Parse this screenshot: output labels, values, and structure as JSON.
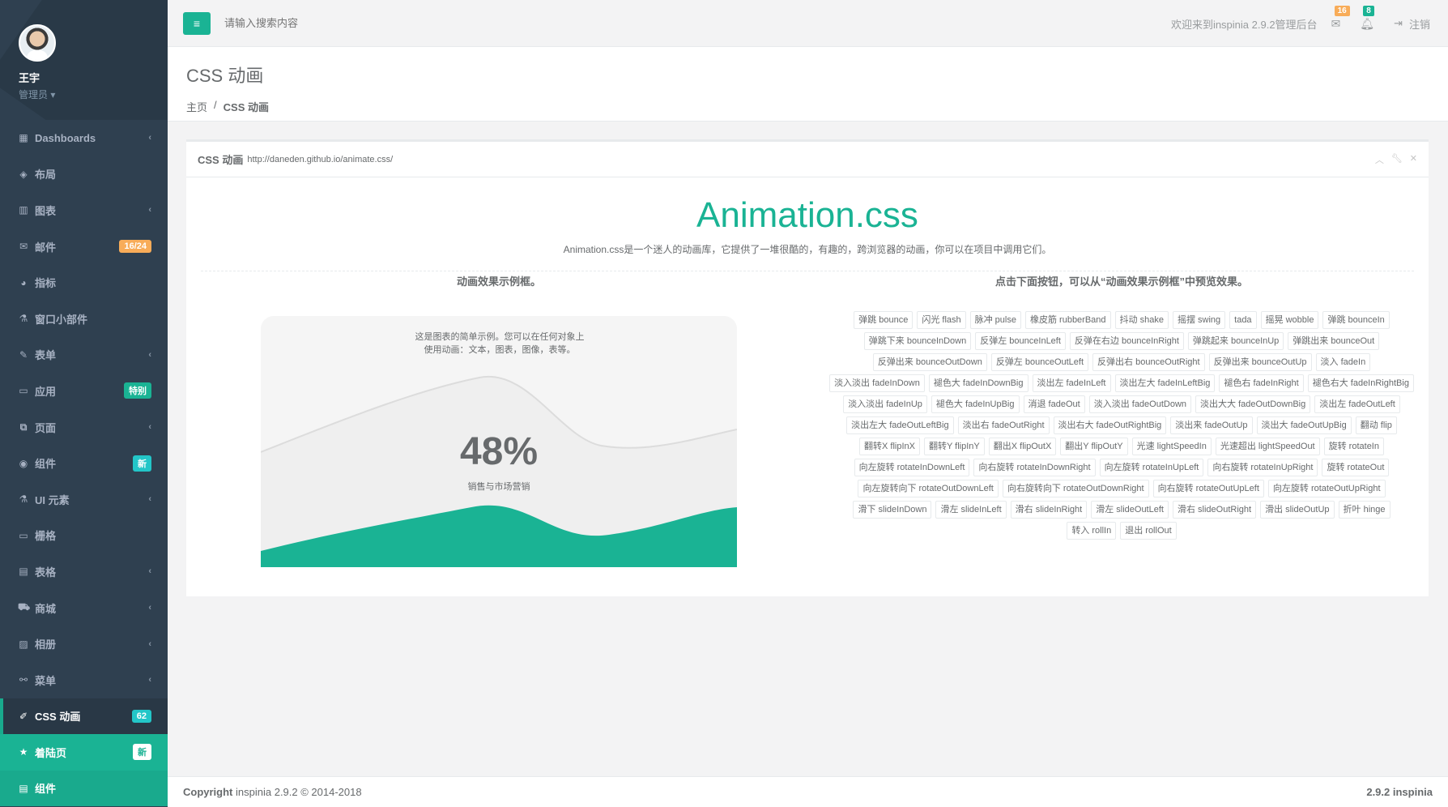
{
  "profile": {
    "name": "王宇",
    "role": "管理员 ▾"
  },
  "sidebar": {
    "items": [
      {
        "icon": "▦",
        "label": "Dashboards",
        "arrow": "‹"
      },
      {
        "icon": "◈",
        "label": "布局"
      },
      {
        "icon": "▥",
        "label": "图表",
        "arrow": "‹"
      },
      {
        "icon": "✉",
        "label": "邮件",
        "badge": "16/24"
      },
      {
        "icon": "◕",
        "label": "指标"
      },
      {
        "icon": "⚗",
        "label": "窗口小部件"
      },
      {
        "icon": "✎",
        "label": "表单",
        "arrow": "‹"
      },
      {
        "icon": "▭",
        "label": "应用",
        "badge": "特别"
      },
      {
        "icon": "⧉",
        "label": "页面",
        "arrow": "‹"
      },
      {
        "icon": "◉",
        "label": "组件",
        "badge": "新"
      },
      {
        "icon": "⚗",
        "label": "UI 元素",
        "arrow": "‹"
      },
      {
        "icon": "▭",
        "label": "栅格"
      },
      {
        "icon": "▤",
        "label": "表格",
        "arrow": "‹"
      },
      {
        "icon": "⛟",
        "label": "商城",
        "arrow": "‹"
      },
      {
        "icon": "▨",
        "label": "相册",
        "arrow": "‹"
      },
      {
        "icon": "⚯",
        "label": "菜单",
        "arrow": "‹"
      },
      {
        "icon": "✐",
        "label": "CSS 动画",
        "badge": "62"
      },
      {
        "icon": "★",
        "label": "着陆页",
        "badge": "新"
      },
      {
        "icon": "▤",
        "label": "组件"
      }
    ]
  },
  "topbar": {
    "toggle": "≡",
    "search_placeholder": "请输入搜索内容",
    "welcome": "欢迎来到inspinia 2.9.2管理后台",
    "mail_count": "16",
    "bell_count": "8",
    "logout": "注销"
  },
  "heading": {
    "title": "CSS 动画",
    "crumb_home": "主页",
    "crumb_sep": "/",
    "crumb_current": "CSS 动画"
  },
  "panel": {
    "title": "CSS 动画",
    "url": "http://daneden.github.io/animate.css/",
    "hero_title": "Animation.css",
    "hero_desc": "Animation.css是一个迷人的动画库，它提供了一堆很酷的，有趣的，跨浏览器的动画，你可以在项目中调用它们。",
    "left_head": "动画效果示例框。",
    "right_head": "点击下面按钮，可以从“动画效果示例框”中预览效果。",
    "demo_text": "这是图表的简单示例。您可以在任何对象上使用动画：文本，图表，图像，表等。",
    "demo_value": "48%",
    "demo_label": "销售与市场营销",
    "buttons": [
      "弹跳 bounce",
      "闪光 flash",
      "脉冲 pulse",
      "橡皮筋 rubberBand",
      "抖动 shake",
      "摇摆 swing",
      "tada",
      "摇晃 wobble",
      "弹跳 bounceIn",
      "弹跳下来 bounceInDown",
      "反弹左 bounceInLeft",
      "反弹在右边 bounceInRight",
      "弹跳起来 bounceInUp",
      "弹跳出来 bounceOut",
      "反弹出来 bounceOutDown",
      "反弹左 bounceOutLeft",
      "反弹出右 bounceOutRight",
      "反弹出来 bounceOutUp",
      "淡入 fadeIn",
      "淡入淡出 fadeInDown",
      "褪色大 fadeInDownBig",
      "淡出左 fadeInLeft",
      "淡出左大 fadeInLeftBig",
      "褪色右 fadeInRight",
      "褪色右大 fadeInRightBig",
      "淡入淡出 fadeInUp",
      "褪色大 fadeInUpBig",
      "消退 fadeOut",
      "淡入淡出 fadeOutDown",
      "淡出大大 fadeOutDownBig",
      "淡出左 fadeOutLeft",
      "淡出左大 fadeOutLeftBig",
      "淡出右 fadeOutRight",
      "淡出右大 fadeOutRightBig",
      "淡出来 fadeOutUp",
      "淡出大 fadeOutUpBig",
      "翻动 flip",
      "翻转X flipInX",
      "翻转Y flipInY",
      "翻出X flipOutX",
      "翻出Y flipOutY",
      "光速 lightSpeedIn",
      "光速超出 lightSpeedOut",
      "旋转 rotateIn",
      "向左旋转 rotateInDownLeft",
      "向右旋转 rotateInDownRight",
      "向左旋转 rotateInUpLeft",
      "向右旋转 rotateInUpRight",
      "旋转 rotateOut",
      "向左旋转向下 rotateOutDownLeft",
      "向右旋转向下 rotateOutDownRight",
      "向右旋转 rotateOutUpLeft",
      "向左旋转 rotateOutUpRight",
      "滑下 slideInDown",
      "滑左 slideInLeft",
      "滑右 slideInRight",
      "滑左 slideOutLeft",
      "滑右 slideOutRight",
      "滑出 slideOutUp",
      "折叶 hinge",
      "转入 rollIn",
      "退出 rollOut"
    ]
  },
  "footer": {
    "copyright_label": "Copyright",
    "copyright_text": "inspinia 2.9.2 © 2014-2018",
    "version": "2.9.2 inspinia"
  },
  "colors": {
    "sidebar": "#2f4050",
    "primary": "#1ab394",
    "warning": "#f8ac59",
    "info": "#23c6c8"
  }
}
